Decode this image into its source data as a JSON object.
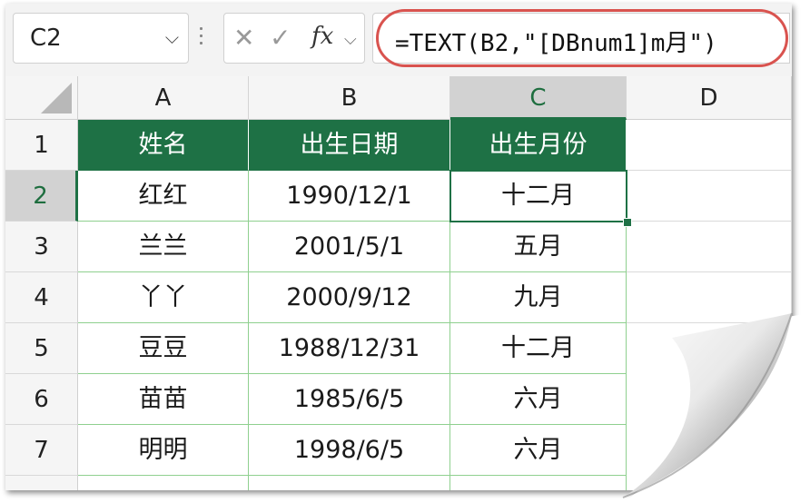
{
  "name_box": {
    "value": "C2"
  },
  "formula_bar": {
    "formula": "=TEXT(B2,\"[DBnum1]m月\")"
  },
  "columns": [
    "A",
    "B",
    "C",
    "D"
  ],
  "rows": [
    "1",
    "2",
    "3",
    "4",
    "5",
    "6",
    "7"
  ],
  "header": [
    "姓名",
    "出生日期",
    "出生月份"
  ],
  "data": [
    [
      "红红",
      "1990/12/1",
      "十二月"
    ],
    [
      "兰兰",
      "2001/5/1",
      "五月"
    ],
    [
      "丫丫",
      "2000/9/12",
      "九月"
    ],
    [
      "豆豆",
      "1988/12/31",
      "十二月"
    ],
    [
      "苗苗",
      "1985/6/5",
      "六月"
    ],
    [
      "明明",
      "1998/6/5",
      "六月"
    ]
  ],
  "colors": {
    "header_fill": "#1e7145",
    "selection": "#1e7145",
    "highlight_ring": "#d9534f",
    "grid_line": "#8fd08f"
  },
  "icons": [
    "chevron-down-icon",
    "cancel-icon",
    "confirm-icon",
    "fx-icon"
  ]
}
